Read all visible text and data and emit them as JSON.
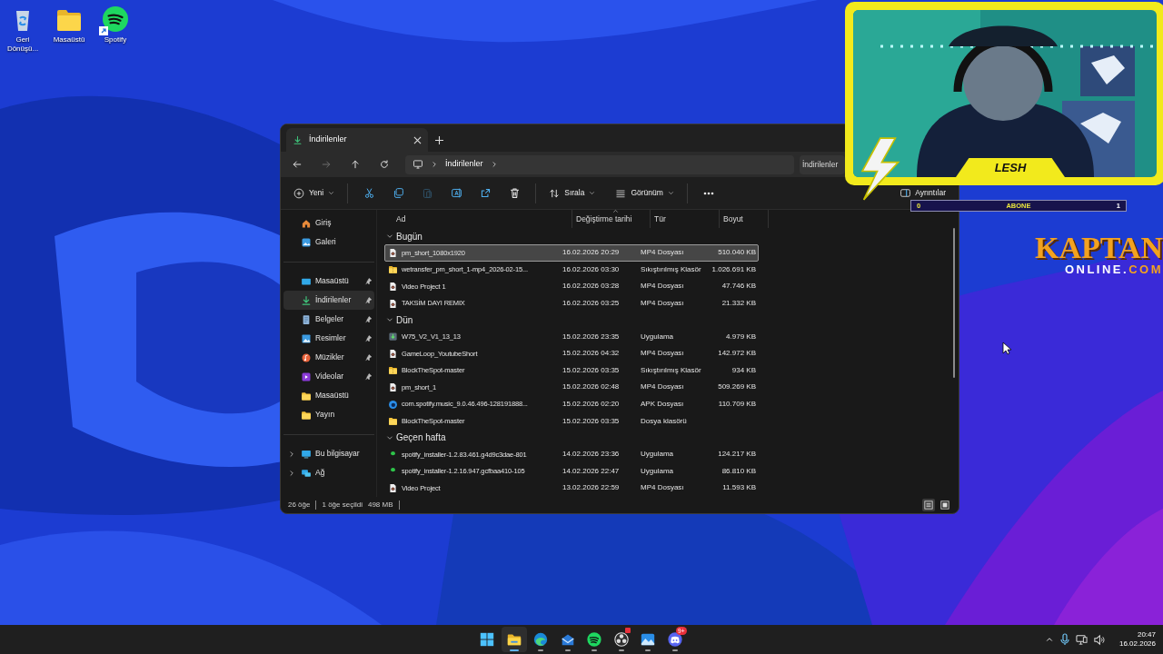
{
  "desktop_icons": [
    {
      "kind": "recycle",
      "label": "Geri Dönüşü...",
      "shortcut": false
    },
    {
      "kind": "folder",
      "label": "Masaüstü",
      "shortcut": false
    },
    {
      "kind": "spotify",
      "label": "Spotify",
      "shortcut": true
    }
  ],
  "explorer": {
    "tab": {
      "label": "İndirilenler"
    },
    "nav": [
      {
        "kind": "back",
        "disabled": false
      },
      {
        "kind": "forward",
        "disabled": true
      },
      {
        "kind": "up",
        "disabled": false
      },
      {
        "kind": "refresh",
        "disabled": false
      }
    ],
    "breadcrumb": [
      "İndirilenler"
    ],
    "search": {
      "placeholder": "İndirilenler"
    },
    "new_button": {
      "label": "Yeni"
    },
    "tools": [
      {
        "kind": "cut",
        "disabled": false
      },
      {
        "kind": "copy",
        "disabled": false
      },
      {
        "kind": "paste",
        "disabled": true
      },
      {
        "kind": "rename",
        "disabled": false
      },
      {
        "kind": "share",
        "disabled": false
      },
      {
        "kind": "delete",
        "disabled": false
      }
    ],
    "sort_button": {
      "label": "Sırala"
    },
    "view_button": {
      "label": "Görünüm"
    },
    "details_button": {
      "label": "Ayrıntılar"
    },
    "columns": [
      {
        "label": "Ad",
        "sorted": false
      },
      {
        "label": "Değiştirme tarihi",
        "sorted": true
      },
      {
        "label": "Tür",
        "sorted": false
      },
      {
        "label": "Boyut",
        "sorted": false
      }
    ],
    "sidebar": {
      "sections": [
        {
          "items": [
            {
              "kind": "home",
              "label": "Giriş",
              "selected": false
            },
            {
              "kind": "gallery",
              "label": "Galeri",
              "selected": false
            }
          ]
        },
        {
          "items": [
            {
              "kind": "desktop",
              "label": "Masaüstü",
              "pinned": true,
              "selected": false
            },
            {
              "kind": "downloads",
              "label": "İndirilenler",
              "pinned": true,
              "selected": true
            },
            {
              "kind": "documents",
              "label": "Belgeler",
              "pinned": true,
              "selected": false
            },
            {
              "kind": "pictures",
              "label": "Resimler",
              "pinned": true,
              "selected": false
            },
            {
              "kind": "music",
              "label": "Müzikler",
              "pinned": true,
              "selected": false
            },
            {
              "kind": "videos",
              "label": "Videolar",
              "pinned": true,
              "selected": false
            },
            {
              "kind": "folder",
              "label": "Masaüstü",
              "pinned": false,
              "selected": false
            },
            {
              "kind": "folder",
              "label": "Yayın",
              "pinned": false,
              "selected": false
            }
          ]
        },
        {
          "items": [
            {
              "kind": "pc",
              "label": "Bu bilgisayar",
              "expanded": false,
              "selected": false
            },
            {
              "kind": "network",
              "label": "Ağ",
              "expanded": false,
              "selected": false
            }
          ]
        }
      ]
    },
    "groups": [
      {
        "label": "Bugün",
        "expanded": true,
        "rows": [
          {
            "kind": "video",
            "name": "pm_short_1080x1920",
            "date": "16.02.2026 20:29",
            "type": "MP4 Dosyası",
            "size": "510.040 KB",
            "selected": true
          },
          {
            "kind": "zip",
            "name": "wetransfer_pm_short_1-mp4_2026-02-15...",
            "date": "16.02.2026 03:30",
            "type": "Sıkıştırılmış Klasör",
            "size": "1.026.691 KB",
            "selected": false
          },
          {
            "kind": "video",
            "name": "Video Project 1",
            "date": "16.02.2026 03:28",
            "type": "MP4 Dosyası",
            "size": "47.746 KB",
            "selected": false
          },
          {
            "kind": "video",
            "name": "TAKSİM DAYI REMIX",
            "date": "16.02.2026 03:25",
            "type": "MP4 Dosyası",
            "size": "21.332 KB",
            "selected": false
          }
        ]
      },
      {
        "label": "Dün",
        "expanded": true,
        "rows": [
          {
            "kind": "app",
            "name": "W75_V2_V1_13_13",
            "date": "15.02.2026 23:35",
            "type": "Uygulama",
            "size": "4.979 KB",
            "selected": false
          },
          {
            "kind": "video",
            "name": "GameLoop_YoutubeShort",
            "date": "15.02.2026 04:32",
            "type": "MP4 Dosyası",
            "size": "142.972 KB",
            "selected": false
          },
          {
            "kind": "zip",
            "name": "BlockTheSpot-master",
            "date": "15.02.2026 03:35",
            "type": "Sıkıştırılmış Klasör",
            "size": "934 KB",
            "selected": false
          },
          {
            "kind": "video",
            "name": "pm_short_1",
            "date": "15.02.2026 02:48",
            "type": "MP4 Dosyası",
            "size": "509.269 KB",
            "selected": false
          },
          {
            "kind": "apk",
            "name": "com.spotify.music_9.0.46.496-128191888...",
            "date": "15.02.2026 02:20",
            "type": "APK Dosyası",
            "size": "110.709 KB",
            "selected": false
          },
          {
            "kind": "folder",
            "name": "BlockTheSpot-master",
            "date": "15.02.2026 03:35",
            "type": "Dosya klasörü",
            "selected": false
          }
        ]
      },
      {
        "label": "Geçen hafta",
        "expanded": true,
        "rows": [
          {
            "kind": "installer",
            "name": "spotify_installer-1.2.83.461.g4d9c3dae-801",
            "date": "14.02.2026 23:36",
            "type": "Uygulama",
            "size": "124.217 KB",
            "selected": false
          },
          {
            "kind": "installer",
            "name": "spotify_installer-1.2.16.947.gcfbaa410-105",
            "date": "14.02.2026 22:47",
            "type": "Uygulama",
            "size": "86.810 KB",
            "selected": false
          },
          {
            "kind": "video",
            "name": "Video Project",
            "date": "13.02.2026 22:59",
            "type": "MP4 Dosyası",
            "size": "11.593 KB",
            "selected": false
          }
        ]
      }
    ],
    "status_bar": {
      "count": "26 öğe",
      "selection": "1 öğe seçildi",
      "size": "498 MB"
    },
    "view_modes": [
      {
        "kind": "details",
        "selected": true
      },
      {
        "kind": "tiles",
        "selected": false
      }
    ]
  },
  "stream_overlay": {
    "name_tag": "LESH",
    "subscriber_bar": {
      "current": "0",
      "label": "ABONE",
      "goal": "1"
    },
    "brand": {
      "word": "KAPTAN",
      "domain": "ONLINE.",
      "tld": "COM"
    }
  },
  "taskbar": {
    "apps": [
      {
        "kind": "start",
        "active": false,
        "running": false
      },
      {
        "kind": "explorer",
        "active": true,
        "running": true
      },
      {
        "kind": "edge",
        "active": false,
        "running": true
      },
      {
        "kind": "mail",
        "active": false,
        "running": true
      },
      {
        "kind": "spotify",
        "active": false,
        "running": true
      },
      {
        "kind": "obs",
        "active": false,
        "running": true,
        "alert": true
      },
      {
        "kind": "photos",
        "active": false,
        "running": true
      },
      {
        "kind": "discord",
        "active": false,
        "running": true,
        "badge": "9+"
      }
    ],
    "time": "20:47",
    "date": "16.02.2026"
  }
}
